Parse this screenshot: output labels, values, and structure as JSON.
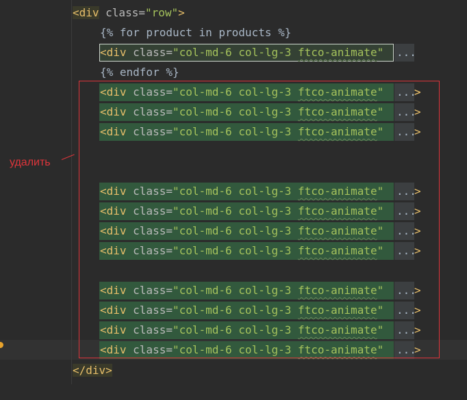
{
  "lines": {
    "open_row": {
      "tag": "<div",
      "attr": " class=",
      "value": "\"row\"",
      "close": ">"
    },
    "for_loop": "{% for product in products %}",
    "product_div": {
      "tag": "<div",
      "attr": " class=",
      "value": "\"col-md-6 col-lg-3 ",
      "value_u": "ftco-animate",
      "value_end": "\"",
      "fold": "...",
      "close": ">"
    },
    "endfor": "{% endfor %}",
    "close_row": "</div>"
  },
  "annotation": {
    "label": "удалить",
    "color": "#e0353b"
  },
  "colors": {
    "background": "#2b2b2b",
    "tag": "#e8bf6a",
    "string": "#a5c25c",
    "highlight": "#32593d",
    "annotation": "#e0353b"
  }
}
